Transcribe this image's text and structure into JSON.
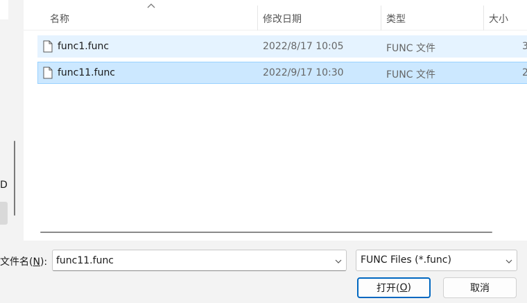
{
  "nav": {
    "partial_label": "D"
  },
  "columns": {
    "name": "名称",
    "date": "修改日期",
    "type": "类型",
    "size": "大小"
  },
  "files": [
    {
      "name": "func1.func",
      "date": "2022/8/17 10:05",
      "type": "FUNC 文件",
      "size": "3",
      "state": "hover"
    },
    {
      "name": "func11.func",
      "date": "2022/9/17 10:30",
      "type": "FUNC 文件",
      "size": "2",
      "state": "selected"
    }
  ],
  "filename": {
    "label_prefix": "文件名(",
    "label_mnemonic": "N",
    "label_suffix": "):",
    "value": "func11.func"
  },
  "filetype": {
    "selected": "FUNC Files (*.func)"
  },
  "buttons": {
    "open_prefix": "打开(",
    "open_mnemonic": "O",
    "open_suffix": ")",
    "cancel": "取消"
  },
  "colors": {
    "selected_row": "#cce8ff",
    "hover_row": "#e5f3ff",
    "accent": "#0067c0"
  }
}
